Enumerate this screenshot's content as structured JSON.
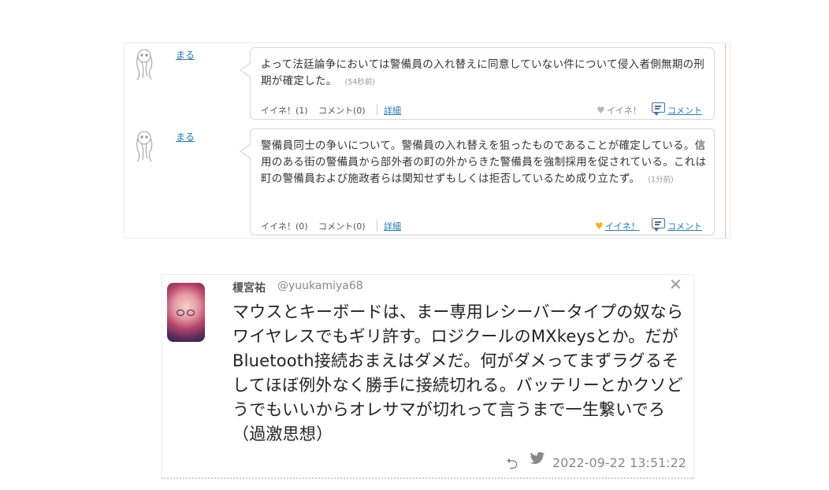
{
  "comments": [
    {
      "user": "まる",
      "text": "よって法廷論争においては警備員の入れ替えに同意していない件について侵入者側無期の刑期が確定した。",
      "time": "(54秒前)",
      "likes_count": "イイネ！(1)",
      "comments_count": "コメント(0)",
      "detail": "詳細",
      "like_label": "イイネ！",
      "like_active": false,
      "comment_label": "コメント"
    },
    {
      "user": "まる",
      "text": "警備員同士の争いについて。警備員の入れ替えを狙ったものであることが確定している。信用のある街の警備員から部外者の町の外からきた警備員を強制採用を促されている。これは町の警備員および施政者らは関知せずもしくは拒否しているため成り立たず。",
      "time": "(1分前)",
      "likes_count": "イイネ！(0)",
      "comments_count": "コメント(0)",
      "detail": "詳細",
      "like_label": "イイネ！",
      "like_active": true,
      "comment_label": "コメント"
    }
  ],
  "tweet": {
    "name": "榎宮祐",
    "handle": "@yuukamiya68",
    "text": "マウスとキーボードは、まー専用レシーバータイプの奴ならワイヤレスでもギリ許す。ロジクールのMXkeysとか。だがBluetooth接続おまえはダメだ。何がダメってまずラグるそしてほぼ例外なく勝手に接続切れる。バッテリーとかクソどうでもいいからオレサマが切れって言うまで一生繋いでろ（過激思想）",
    "date": "2022-09-22 13:51:22",
    "close_glyph": "✕",
    "reply_glyph": "⮌",
    "bird_glyph": "🐦"
  },
  "colors": {
    "link": "#2a7ab0",
    "like_inactive": "#b5b5b5",
    "like_active": "#f2b42a"
  },
  "icons": [
    "ghost-avatar-icon",
    "heart-icon",
    "comment-bubble-icon",
    "close-icon",
    "reply-icon",
    "twitter-bird-icon"
  ]
}
